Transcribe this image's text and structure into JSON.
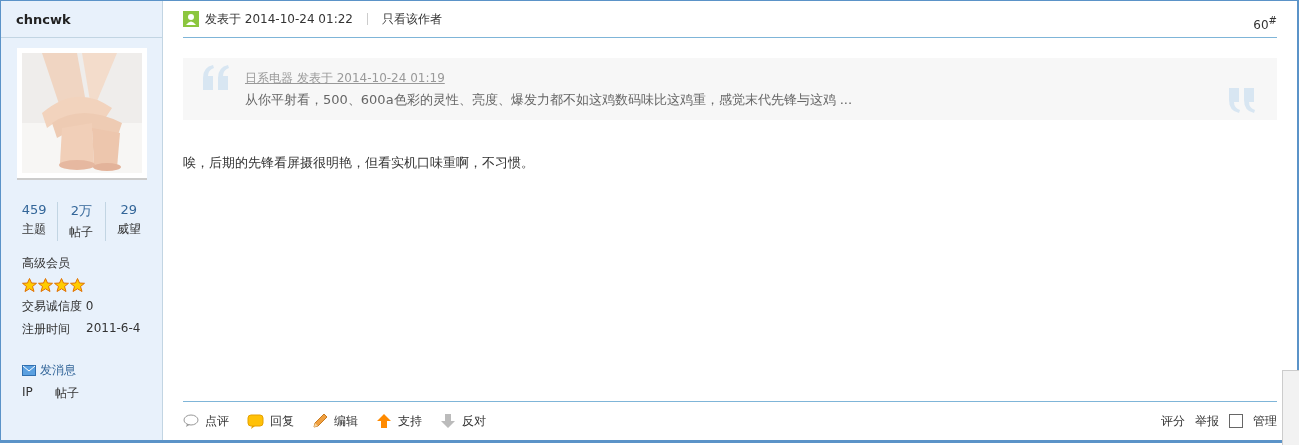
{
  "author": {
    "name": "chncwk",
    "avatar": {
      "kind": "picture"
    },
    "stats": [
      {
        "value": "459",
        "label": "主题"
      },
      {
        "value": "2万",
        "label": "帖子"
      },
      {
        "value": "29",
        "label": "威望"
      }
    ],
    "group": "高级会员",
    "stars": 4,
    "credit": "交易诚信度 0",
    "registered_label": "注册时间",
    "registered": "2011-6-4",
    "message_link": "发消息",
    "tools": [
      "IP",
      "帖子"
    ]
  },
  "post": {
    "posted": "发表于 2014-10-24 01:22",
    "only_author": "只看该作者",
    "floor": "60",
    "floor_mark": "#",
    "quote": {
      "source": "日系电器 发表于 2014-10-24 01:19",
      "text": "从你平射看，500、600a色彩的灵性、亮度、爆发力都不如这鸡数码味比这鸡重，感觉末代先锋与这鸡 ..."
    },
    "body": "唉，后期的先锋看屏摄很明艳，但看实机口味重啊，不习惯。",
    "actions": [
      {
        "kind": "comment",
        "label": "点评"
      },
      {
        "kind": "reply",
        "label": "回复"
      },
      {
        "kind": "edit",
        "label": "编辑"
      },
      {
        "kind": "support",
        "label": "支持"
      },
      {
        "kind": "oppose",
        "label": "反对"
      }
    ],
    "right_actions": [
      {
        "kind": "link",
        "label": "评分"
      },
      {
        "kind": "link",
        "label": "举报"
      },
      {
        "kind": "checkbox",
        "label": "管理",
        "checked": false
      }
    ]
  }
}
